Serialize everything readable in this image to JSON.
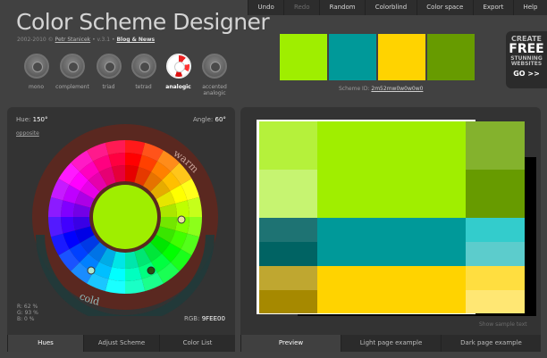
{
  "header": {
    "logo": "Color Scheme Designer",
    "copyright": "2002-2010 ©",
    "author": "Petr Stanicek",
    "version": "• v.3.1 •",
    "blog": "Blog & News"
  },
  "menu": [
    {
      "label": "Undo",
      "enabled": true
    },
    {
      "label": "Redo",
      "enabled": false
    },
    {
      "label": "Random",
      "enabled": true
    },
    {
      "label": "Colorblind",
      "enabled": true
    },
    {
      "label": "Color space",
      "enabled": true
    },
    {
      "label": "Export",
      "enabled": true
    },
    {
      "label": "Help",
      "enabled": true
    }
  ],
  "modes": [
    {
      "label": "mono",
      "icon": "mono-icon",
      "active": false
    },
    {
      "label": "complement",
      "icon": "complement-icon",
      "active": false
    },
    {
      "label": "triad",
      "icon": "triad-icon",
      "active": false
    },
    {
      "label": "tetrad",
      "icon": "tetrad-icon",
      "active": false
    },
    {
      "label": "analogic",
      "icon": "analogic-icon",
      "active": true
    },
    {
      "label": "accented analogic",
      "icon": "accented-analogic-icon",
      "active": false
    }
  ],
  "scheme": {
    "colors": [
      "#9FEE00",
      "#009999",
      "#FFD300",
      "#679B00"
    ],
    "id_label": "Scheme ID:",
    "id_value": "2m52mw0w0w0w0"
  },
  "ad": {
    "line1": "CREATE",
    "line2": "FREE",
    "line3": "STUNNING",
    "line4": "WEBSITES",
    "line5": "GO >>"
  },
  "wheel": {
    "hue_label": "Hue:",
    "hue_value": "150°",
    "angle_label": "Angle:",
    "angle_value": "60°",
    "opposite": "opposite",
    "warm": "warm",
    "cold": "cold",
    "rgb_label": "RGB:",
    "rgb_value": "9FEE00",
    "r": "R: 62 %",
    "g": "G: 93 %",
    "b": "B: 0 %"
  },
  "left_tabs": [
    {
      "label": "Hues",
      "active": true
    },
    {
      "label": "Adjust Scheme",
      "active": false
    },
    {
      "label": "Color List",
      "active": false
    }
  ],
  "right_tabs": [
    {
      "label": "Preview",
      "active": true
    },
    {
      "label": "Light page example",
      "active": false
    },
    {
      "label": "Dark page example",
      "active": false
    }
  ],
  "preview": {
    "show_sample": "Show sample text",
    "blocks": [
      {
        "color": "#B5F13B",
        "span": 1
      },
      {
        "color": "#A0EE00",
        "span": 1,
        "rowspan": 2
      },
      {
        "color": "#84B22D",
        "span": 1
      },
      {
        "color": "#C6F471",
        "span": 1
      },
      {
        "color": "#679B00",
        "span": 1
      },
      {
        "color": "#1E7373",
        "span": 1
      },
      {
        "color": "#009999",
        "span": 1,
        "rowspan": 2
      },
      {
        "color": "#33CCCC",
        "span": 1
      },
      {
        "color": "#006363",
        "span": 1
      },
      {
        "color": "#5CCCCC",
        "span": 1
      },
      {
        "color": "#BFA730",
        "span": 1
      },
      {
        "color": "#FFD300",
        "span": 1,
        "rowspan": 2
      },
      {
        "color": "#FFDE40",
        "span": 1
      },
      {
        "color": "#A68900",
        "span": 1
      },
      {
        "color": "#FFE773",
        "span": 1
      }
    ]
  }
}
